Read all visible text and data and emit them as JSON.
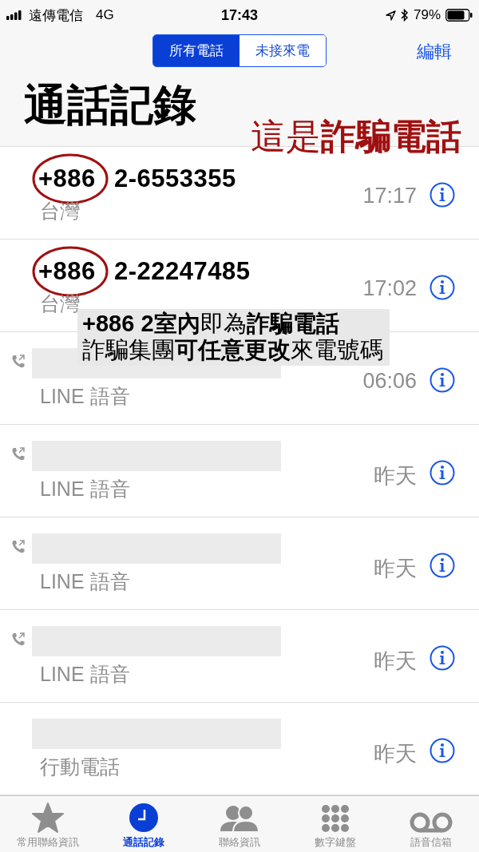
{
  "status_bar": {
    "carrier": "遠傳電信",
    "network": "4G",
    "time": "17:43",
    "battery": "79%"
  },
  "segments": [
    {
      "label": "所有電話",
      "selected": true
    },
    {
      "label": "未接來電",
      "selected": false
    }
  ],
  "edit_button": "編輯",
  "title": "通話記錄",
  "annotation_title": "這是**詐騙電話**",
  "calls": [
    {
      "kind": "number",
      "number": "+886 2-6553355",
      "subtitle": "台灣",
      "time": "17:17",
      "circled": true
    },
    {
      "kind": "number",
      "number": "+886 2-22247485",
      "subtitle": "台灣",
      "time": "17:02",
      "circled": true
    },
    {
      "kind": "redacted_app",
      "subtitle": "LINE 語音",
      "time": "06:06"
    },
    {
      "kind": "redacted_app",
      "subtitle": "LINE 語音",
      "time": "昨天"
    },
    {
      "kind": "redacted_app",
      "subtitle": "LINE 語音",
      "time": "昨天"
    },
    {
      "kind": "redacted_app",
      "subtitle": "LINE 語音",
      "time": "昨天"
    },
    {
      "kind": "redacted",
      "subtitle": "行動電話",
      "time": "昨天"
    }
  ],
  "annotation_note": [
    "**+886 2室內**即為**詐騙電話**",
    "詐騙集團**可任意更改**來電號碼"
  ],
  "tabs": [
    {
      "label": "常用聯絡資訊",
      "kind": "star",
      "selected": false
    },
    {
      "label": "通話記錄",
      "kind": "clock",
      "selected": true
    },
    {
      "label": "聯絡資訊",
      "kind": "contacts",
      "selected": false
    },
    {
      "label": "數字鍵盤",
      "kind": "keypad",
      "selected": false
    },
    {
      "label": "語音信箱",
      "kind": "voicemail",
      "selected": false
    }
  ]
}
